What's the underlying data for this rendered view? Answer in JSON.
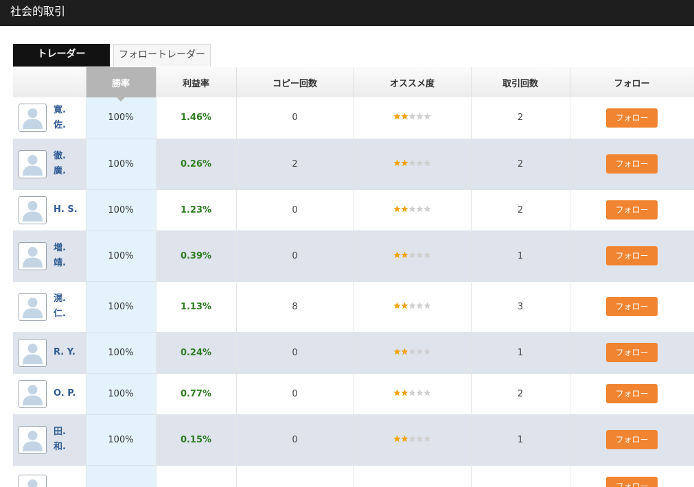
{
  "header": {
    "title": "社会的取引"
  },
  "tabs": [
    {
      "label": "トレーダー",
      "active": true
    },
    {
      "label": "フォロートレーダー",
      "active": false
    }
  ],
  "table": {
    "columns": [
      "",
      "勝率",
      "利益率",
      "コピー回数",
      "オススメ度",
      "取引回数",
      "フォロー"
    ],
    "sorted_column": "勝率",
    "follow_label": "フォロー",
    "rows": [
      {
        "name": "寛. 佐.",
        "win_rate": "100%",
        "profit": "1.46%",
        "copies": "0",
        "rating": 2,
        "trades": "2"
      },
      {
        "name": "徹. 廣.",
        "win_rate": "100%",
        "profit": "0.26%",
        "copies": "2",
        "rating": 2,
        "trades": "2"
      },
      {
        "name": "H. S.",
        "win_rate": "100%",
        "profit": "1.23%",
        "copies": "0",
        "rating": 2,
        "trades": "2"
      },
      {
        "name": "増. 靖.",
        "win_rate": "100%",
        "profit": "0.39%",
        "copies": "0",
        "rating": 2,
        "trades": "1"
      },
      {
        "name": "滉. 仁.",
        "win_rate": "100%",
        "profit": "1.13%",
        "copies": "8",
        "rating": 2,
        "trades": "3"
      },
      {
        "name": "R. Y.",
        "win_rate": "100%",
        "profit": "0.24%",
        "copies": "0",
        "rating": 2,
        "trades": "1"
      },
      {
        "name": "O. P.",
        "win_rate": "100%",
        "profit": "0.77%",
        "copies": "0",
        "rating": 2,
        "trades": "2"
      },
      {
        "name": "田. 和.",
        "win_rate": "100%",
        "profit": "0.15%",
        "copies": "0",
        "rating": 2,
        "trades": "1"
      }
    ]
  },
  "colors": {
    "accent": "#f08431",
    "star_on": "#f2a313",
    "star_off": "#cfcfcf",
    "profit": "#2e7d22",
    "name": "#2f5a93"
  },
  "icons": {
    "avatar": "user-silhouette-icon",
    "star": "star-icon",
    "sort_indicator": "caret-down-icon"
  }
}
